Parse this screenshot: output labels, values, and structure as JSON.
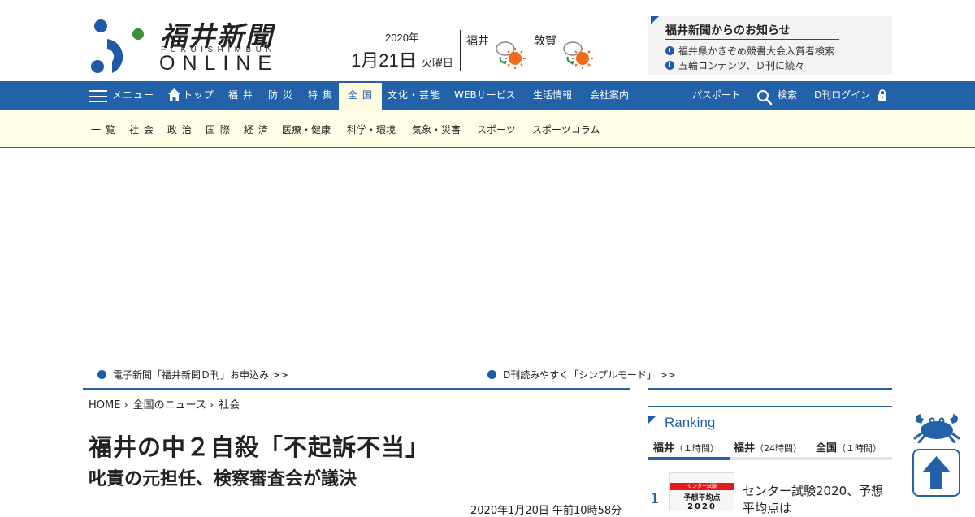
{
  "header": {
    "logo": {
      "kanji": "福井新聞",
      "sub": "FUKUISHIMBUN",
      "online": "ONLINE",
      "colors": {
        "blue": "#1e5aa8",
        "green": "#3d8f3a"
      }
    },
    "date": {
      "year": "2020年",
      "monthday": "1月21日",
      "weekday": "火曜日"
    },
    "weather": [
      {
        "city": "福井",
        "icon": "cloudy-then-sunny-icon"
      },
      {
        "city": "敦賀",
        "icon": "cloudy-then-sunny-icon"
      }
    ],
    "notice": {
      "title": "福井新聞からのお知らせ",
      "items": [
        "福井県かきぞめ競書大会入賞者検索",
        "五輪コンテンツ、Ｄ刊に続々"
      ]
    }
  },
  "nav": {
    "menu_label": "メニュー",
    "items": [
      "トップ",
      "福 井",
      "防 災",
      "特 集",
      "全 国",
      "文化・芸能",
      "WEBサービス",
      "生活情報",
      "会社案内"
    ],
    "active": "全 国",
    "right": {
      "passport": "パスポート",
      "search": "検索",
      "login": "D刊ログイン"
    },
    "colors": {
      "bar": "#2361a8",
      "active_bg": "#fffbe0"
    }
  },
  "subnav": {
    "items": [
      "一 覧",
      "社 会",
      "政 治",
      "国 際",
      "経 済",
      "医療・健康",
      "科学・環境",
      "気象・災害",
      "スポーツ",
      "スポーツコラム"
    ]
  },
  "promos": [
    "電子新聞「福井新聞Ｄ刊」お申込み >>",
    "D刊読みやすく「シンプルモード」 >>"
  ],
  "breadcrumb": [
    "HOME",
    "全国のニュース",
    "社会"
  ],
  "article": {
    "title": "福井の中２自殺「不起訴不当」",
    "subtitle": "叱責の元担任、検察審査会が議決",
    "published": "2020年1月20日 午前10時58分"
  },
  "ranking": {
    "heading": "Ranking",
    "tabs": [
      {
        "label": "福井",
        "span": "（１時間）"
      },
      {
        "label": "福井",
        "span": "（24時間）"
      },
      {
        "label": "全国",
        "span": "（１時間）"
      }
    ],
    "items": [
      {
        "rank": "1",
        "thumb_band": "センター試験",
        "thumb_line1": "予想平均点",
        "thumb_line2": "2020",
        "text": "センター試験2020、予想平均点は"
      }
    ]
  }
}
